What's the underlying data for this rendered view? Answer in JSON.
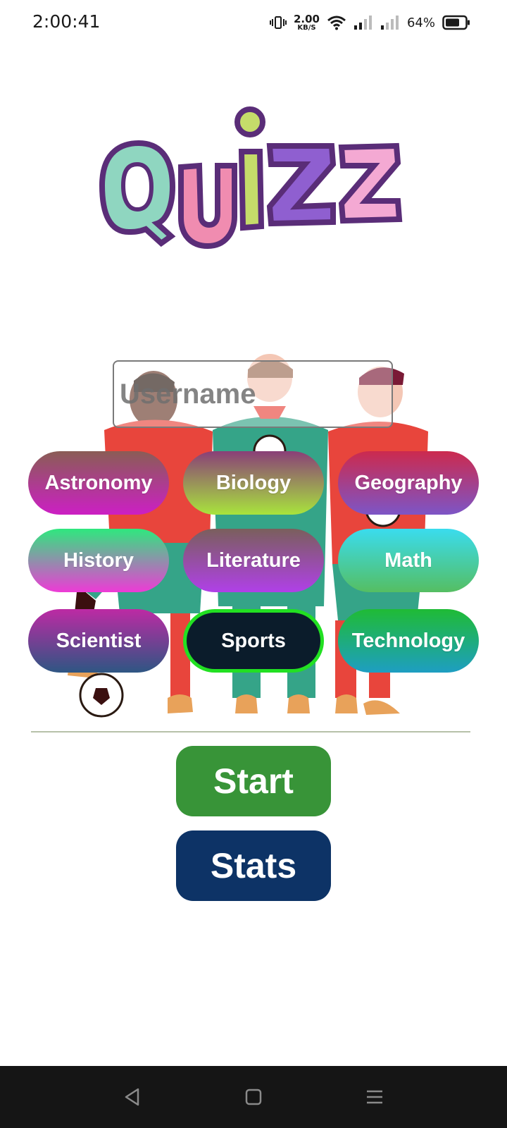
{
  "status_bar": {
    "time": "2:00:41",
    "net_speed_value": "2.00",
    "net_speed_unit": "KB/S",
    "battery": "64%"
  },
  "logo": {
    "text": "QUIZZ",
    "colors": [
      "#8fd6c0",
      "#f08cb0",
      "#c5dc6a",
      "#8f5fd0",
      "#f4a9d3"
    ],
    "outline": "#5a2d78"
  },
  "username": {
    "placeholder": "Username",
    "value": ""
  },
  "categories": [
    {
      "label": "Astronomy",
      "gradient": [
        "#8a5d55",
        "#cc1fc4"
      ],
      "selected": false
    },
    {
      "label": "Biology",
      "gradient": [
        "#8a3f78",
        "#a8e43c"
      ],
      "selected": false
    },
    {
      "label": "Geography",
      "gradient": [
        "#cc2a4e",
        "#7d55c6"
      ],
      "selected": false
    },
    {
      "label": "History",
      "gradient": [
        "#2ee87e",
        "#ee3ad6"
      ],
      "selected": false
    },
    {
      "label": "Literature",
      "gradient": [
        "#7a5f5c",
        "#b040e8"
      ],
      "selected": false
    },
    {
      "label": "Math",
      "gradient": [
        "#3adcee",
        "#55be62"
      ],
      "selected": false
    },
    {
      "label": "Scientist",
      "gradient": [
        "#bd2aa4",
        "#2e5683"
      ],
      "selected": false
    },
    {
      "label": "Sports",
      "gradient": [
        "#0b1c2b",
        "#0b1c2b"
      ],
      "selected": true
    },
    {
      "label": "Technology",
      "gradient": [
        "#1fbb35",
        "#1e9ec2"
      ],
      "selected": false
    }
  ],
  "buttons": {
    "start_label": "Start",
    "start_color": "#389438",
    "stats_label": "Stats",
    "stats_color": "#0d3366"
  },
  "nav_bar": {
    "back_icon": "back-triangle-icon",
    "home_icon": "home-square-icon",
    "menu_icon": "menu-lines-icon"
  }
}
